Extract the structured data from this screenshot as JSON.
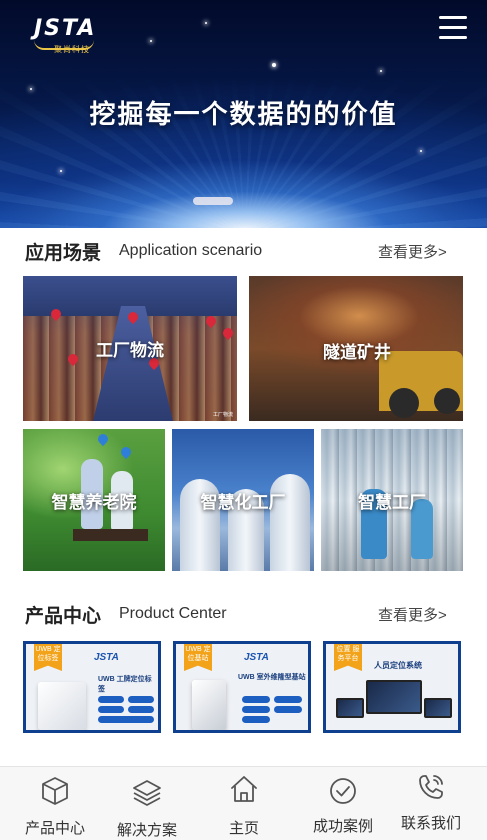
{
  "header": {
    "logo_text": "JSTA",
    "logo_sub": "聚尚科技",
    "menu_icon": "hamburger-menu-icon"
  },
  "hero": {
    "slogan": "挖掘每一个数据的的价值",
    "active_slide": 1
  },
  "application": {
    "title_cn": "应用场景",
    "title_en": "Application scenario",
    "more": "查看更多>",
    "tiles": [
      {
        "label": "工厂物流",
        "caption": "工厂物流"
      },
      {
        "label": "隧道矿井"
      },
      {
        "label": "智慧养老院"
      },
      {
        "label": "智慧化工厂"
      },
      {
        "label": "智慧工厂"
      }
    ]
  },
  "products": {
    "title_cn": "产品中心",
    "title_en": "Product Center",
    "more": "查看更多>",
    "cards": [
      {
        "ribbon": "UWB 定位标签",
        "brand": "JSTA",
        "name": "UWB 工牌定位标签"
      },
      {
        "ribbon": "UWB 定位基站",
        "brand": "JSTA",
        "name": "UWB 室外维隆型基站"
      },
      {
        "ribbon": "位置 服务平台",
        "brand": "",
        "name": "人员定位系统"
      }
    ]
  },
  "bottom_nav": {
    "items": [
      {
        "label": "产品中心",
        "icon": "cube-icon"
      },
      {
        "label": "解决方案",
        "icon": "layers-icon"
      },
      {
        "label": "主页",
        "icon": "home-icon"
      },
      {
        "label": "成功案例",
        "icon": "check-circle-icon"
      },
      {
        "label": "联系我们",
        "icon": "phone-icon"
      }
    ]
  },
  "colors": {
    "hero_dark": "#020a2a",
    "hero_blue": "#1a56b8",
    "ribbon": "#f2a31a",
    "card_border": "#0f3f8f",
    "nav_bg": "#f7f7f7"
  }
}
